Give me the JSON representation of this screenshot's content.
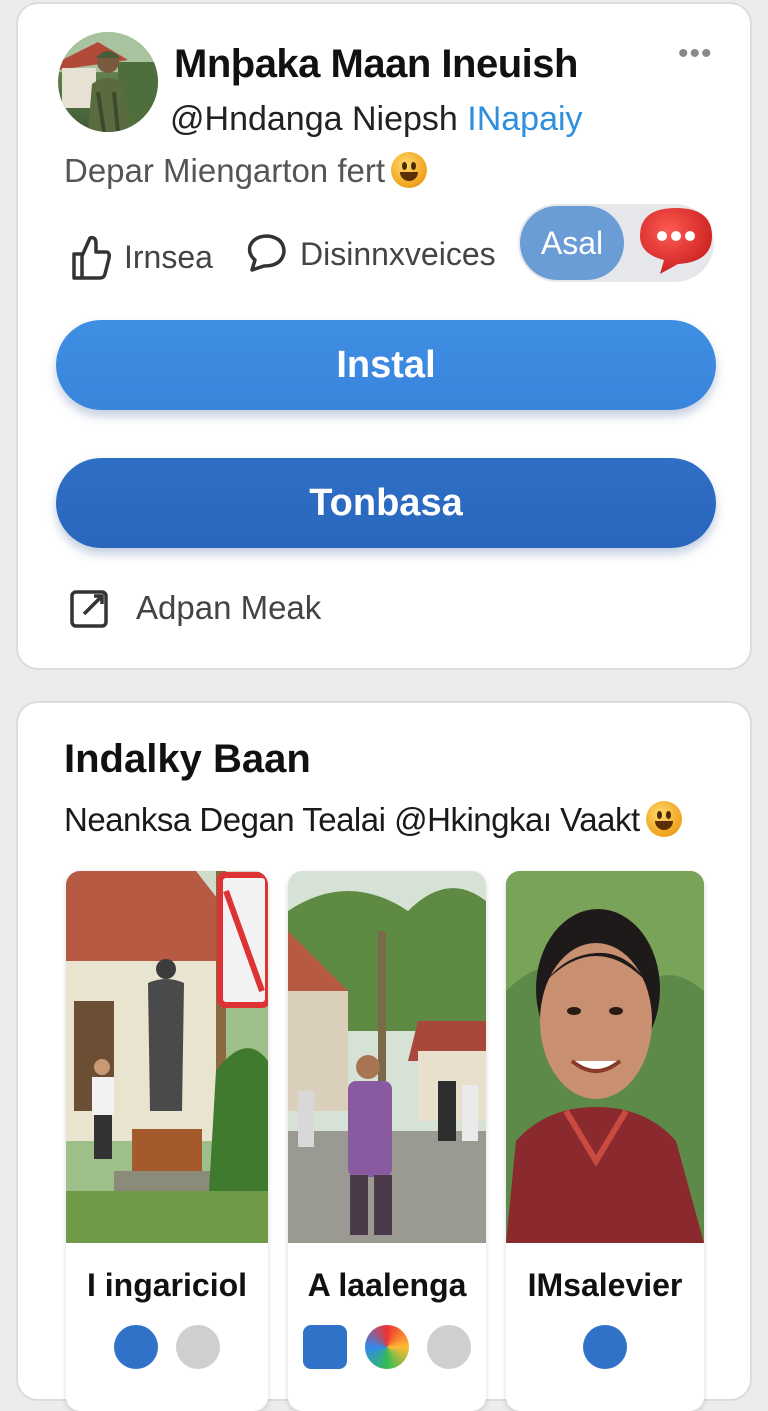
{
  "profile": {
    "name": "Mnþaka Maan Ineuish",
    "handle": "@Hndanga Niepsh",
    "handle_link": "INapaiy",
    "bio": "Depar Miengarton fert",
    "more_label": "•••",
    "actions": {
      "like_label": "Irnsea",
      "discuss_label": "Disinnxveices"
    },
    "toggle": {
      "label": "Asal",
      "bubble_label": "•••"
    },
    "install_label": "Instal",
    "secondary_label": "Tonbasa",
    "edit_label": "Adpan Meak"
  },
  "feature": {
    "title": "Indalky Baan",
    "subtitle": "Neanksa Degan Tealai @Hkingkaı Vaakt",
    "tiles": [
      {
        "title": "I ingariciol",
        "photo": "statue-and-building-photo"
      },
      {
        "title": "A laalenga",
        "photo": "village-street-crowd-photo"
      },
      {
        "title": "IMsalevier",
        "photo": "smiling-woman-portrait-photo"
      }
    ]
  },
  "colors": {
    "primary": "#3a84dc",
    "secondary": "#2a66bd",
    "link": "#2f8fdc",
    "bubble": "#e0302e"
  }
}
